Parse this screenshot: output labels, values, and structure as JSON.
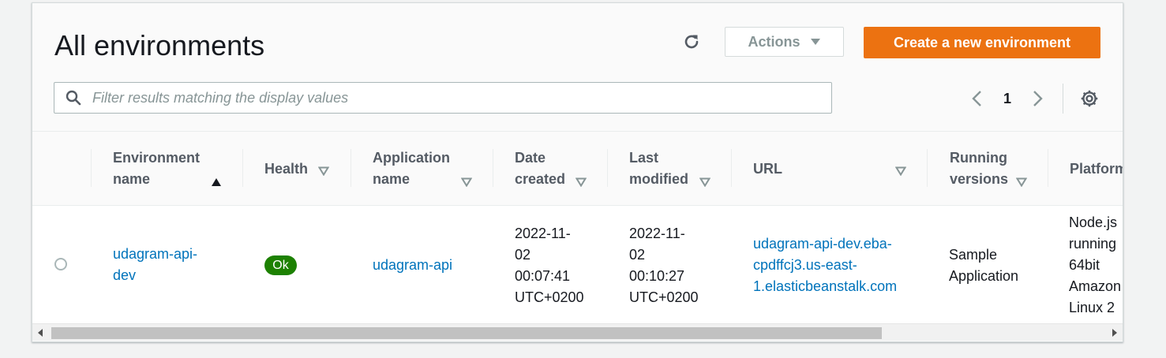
{
  "header": {
    "title": "All environments",
    "actions_label": "Actions",
    "create_label": "Create a new environment"
  },
  "filter": {
    "placeholder": "Filter results matching the display values"
  },
  "pagination": {
    "current_page": "1"
  },
  "table": {
    "columns": [
      {
        "line1": "Environment",
        "line2": "name",
        "sorted": "ascending"
      },
      {
        "line1": "Health",
        "line2": ""
      },
      {
        "line1": "Application",
        "line2": "name"
      },
      {
        "line1": "Date",
        "line2": "created"
      },
      {
        "line1": "Last",
        "line2": "modified"
      },
      {
        "line1": "URL",
        "line2": ""
      },
      {
        "line1": "Running",
        "line2": "versions"
      },
      {
        "line1": "Platform",
        "line2": ""
      }
    ],
    "rows": [
      {
        "environment_name": [
          "udagram-api-",
          "dev"
        ],
        "health": "Ok",
        "application_name": "udagram-api",
        "date_created": [
          "2022-11-",
          "02",
          "00:07:41",
          "UTC+0200"
        ],
        "last_modified": [
          "2022-11-",
          "02",
          "00:10:27",
          "UTC+0200"
        ],
        "url": [
          "udagram-api-dev.eba-",
          "cpdffcj3.us-east-",
          "1.elasticbeanstalk.com"
        ],
        "running_versions": [
          "Sample",
          "Application"
        ],
        "platform": [
          "Node.js",
          "running",
          "64bit",
          "Amazon",
          "Linux 2"
        ]
      }
    ]
  },
  "colors": {
    "accent": "#ec7211",
    "link": "#0073bb",
    "ok_badge": "#1d8102"
  }
}
